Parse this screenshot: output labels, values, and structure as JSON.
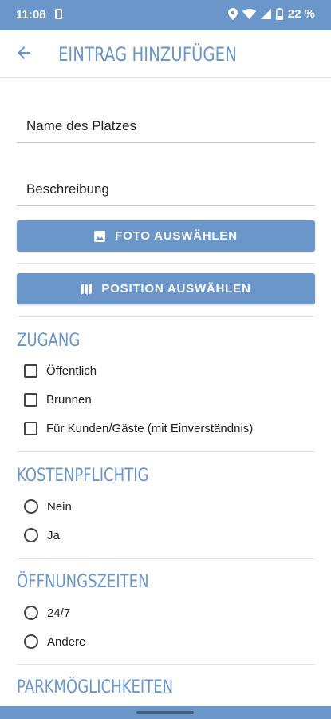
{
  "status_bar": {
    "time": "11:08",
    "battery": "22 %"
  },
  "app_bar": {
    "title": "EINTRAG HINZUFÜGEN"
  },
  "form": {
    "name_field": {
      "placeholder": "Name des Platzes",
      "value": ""
    },
    "description_field": {
      "placeholder": "Beschreibung",
      "value": ""
    },
    "photo_button": "FOTO AUSWÄHLEN",
    "position_button": "POSITION AUSWÄHLEN"
  },
  "access": {
    "title": "ZUGANG",
    "options": [
      {
        "label": "Öffentlich",
        "checked": false
      },
      {
        "label": "Brunnen",
        "checked": false
      },
      {
        "label": "Für Kunden/Gäste (mit Einverständnis)",
        "checked": false
      }
    ]
  },
  "cost": {
    "title": "KOSTENPFLICHTIG",
    "options": [
      {
        "label": "Nein",
        "selected": false
      },
      {
        "label": "Ja",
        "selected": false
      }
    ]
  },
  "opening": {
    "title": "ÖFFNUNGSZEITEN",
    "options": [
      {
        "label": "24/7",
        "selected": false
      },
      {
        "label": "Andere",
        "selected": false
      }
    ]
  },
  "parking": {
    "title": "PARKMÖGLICHKEITEN"
  },
  "colors": {
    "accent": "#6b96c9"
  }
}
